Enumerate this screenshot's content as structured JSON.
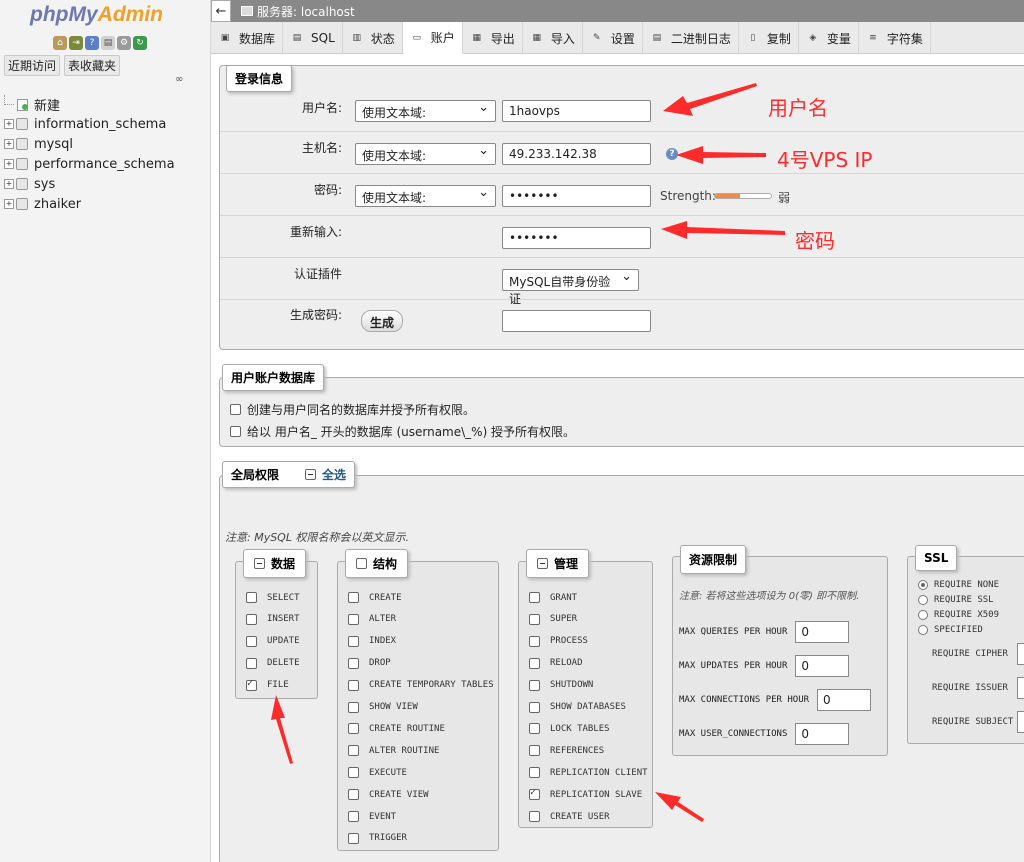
{
  "nav": {
    "logo_php": "php",
    "logo_my": "My",
    "logo_admin": "Admin",
    "recent_label": "近期访问",
    "favorites_label": "表收藏夹",
    "tree": [
      {
        "label": "新建",
        "kind": "new"
      },
      {
        "label": "information_schema",
        "kind": "db"
      },
      {
        "label": "mysql",
        "kind": "db"
      },
      {
        "label": "performance_schema",
        "kind": "db"
      },
      {
        "label": "sys",
        "kind": "db"
      },
      {
        "label": "zhaiker",
        "kind": "db"
      }
    ]
  },
  "topbar": {
    "back_glyph": "←",
    "server_label": "服务器: localhost"
  },
  "tabs": [
    {
      "label": "数据库",
      "icon": "database-icon"
    },
    {
      "label": "SQL",
      "icon": "sql-icon"
    },
    {
      "label": "状态",
      "icon": "status-icon"
    },
    {
      "label": "账户",
      "icon": "users-icon",
      "active": true
    },
    {
      "label": "导出",
      "icon": "export-icon"
    },
    {
      "label": "导入",
      "icon": "import-icon"
    },
    {
      "label": "设置",
      "icon": "wrench-icon"
    },
    {
      "label": "二进制日志",
      "icon": "binlog-icon"
    },
    {
      "label": "复制",
      "icon": "replication-icon"
    },
    {
      "label": "变量",
      "icon": "variables-icon"
    },
    {
      "label": "字符集",
      "icon": "charset-icon"
    }
  ],
  "login": {
    "legend": "登录信息",
    "username_label": "用户名:",
    "username_mode": "使用文本域:",
    "username_value": "1haovps",
    "host_label": "主机名:",
    "host_mode": "使用文本域:",
    "host_value": "49.233.142.38",
    "password_label": "密码:",
    "password_mode": "使用文本域:",
    "password_value": "•••••••",
    "strength_label": "Strength:",
    "strength_text": "弱",
    "strength_level": 0.45,
    "retype_label": "重新输入:",
    "retype_value": "•••••••",
    "auth_label": "认证插件",
    "auth_value": "MySQL自带身份验证",
    "generate_label": "生成密码:",
    "generate_button": "生成",
    "generated_value": ""
  },
  "user_db": {
    "legend": "用户账户数据库",
    "option1": "创建与用户同名的数据库并授予所有权限。",
    "option2": "给以 用户名_ 开头的数据库 (username\\_%) 授予所有权限。"
  },
  "global": {
    "legend": "全局权限",
    "check_all": "全选",
    "note": "注意: MySQL 权限名称会以英文显示.",
    "data": {
      "legend": "数据",
      "items": [
        {
          "name": "SELECT",
          "checked": false
        },
        {
          "name": "INSERT",
          "checked": false
        },
        {
          "name": "UPDATE",
          "checked": false
        },
        {
          "name": "DELETE",
          "checked": false
        },
        {
          "name": "FILE",
          "checked": true
        }
      ]
    },
    "structure": {
      "legend": "结构",
      "items": [
        {
          "name": "CREATE",
          "checked": false
        },
        {
          "name": "ALTER",
          "checked": false
        },
        {
          "name": "INDEX",
          "checked": false
        },
        {
          "name": "DROP",
          "checked": false
        },
        {
          "name": "CREATE TEMPORARY TABLES",
          "checked": false
        },
        {
          "name": "SHOW VIEW",
          "checked": false
        },
        {
          "name": "CREATE ROUTINE",
          "checked": false
        },
        {
          "name": "ALTER ROUTINE",
          "checked": false
        },
        {
          "name": "EXECUTE",
          "checked": false
        },
        {
          "name": "CREATE VIEW",
          "checked": false
        },
        {
          "name": "EVENT",
          "checked": false
        },
        {
          "name": "TRIGGER",
          "checked": false
        }
      ]
    },
    "admin": {
      "legend": "管理",
      "items": [
        {
          "name": "GRANT",
          "checked": false
        },
        {
          "name": "SUPER",
          "checked": false
        },
        {
          "name": "PROCESS",
          "checked": false
        },
        {
          "name": "RELOAD",
          "checked": false
        },
        {
          "name": "SHUTDOWN",
          "checked": false
        },
        {
          "name": "SHOW DATABASES",
          "checked": false
        },
        {
          "name": "LOCK TABLES",
          "checked": false
        },
        {
          "name": "REFERENCES",
          "checked": false
        },
        {
          "name": "REPLICATION CLIENT",
          "checked": false
        },
        {
          "name": "REPLICATION SLAVE",
          "checked": true
        },
        {
          "name": "CREATE USER",
          "checked": false
        }
      ]
    },
    "resources": {
      "legend": "资源限制",
      "note": "注意: 若将这些选项设为 0(零) 即不限制.",
      "items": [
        {
          "label": "MAX QUERIES PER HOUR",
          "value": "0"
        },
        {
          "label": "MAX UPDATES PER HOUR",
          "value": "0"
        },
        {
          "label": "MAX CONNECTIONS PER HOUR",
          "value": "0"
        },
        {
          "label": "MAX USER_CONNECTIONS",
          "value": "0"
        }
      ]
    },
    "ssl": {
      "legend": "SSL",
      "options": [
        {
          "label": "REQUIRE NONE",
          "checked": true
        },
        {
          "label": "REQUIRE SSL",
          "checked": false
        },
        {
          "label": "REQUIRE X509",
          "checked": false
        },
        {
          "label": "SPECIFIED",
          "checked": false
        }
      ],
      "fields": [
        "REQUIRE CIPHER",
        "REQUIRE ISSUER",
        "REQUIRE SUBJECT"
      ]
    }
  },
  "annotations": {
    "username": "用户名",
    "host": "4号VPS IP",
    "password": "密码",
    "color": "#ff2b2b"
  }
}
